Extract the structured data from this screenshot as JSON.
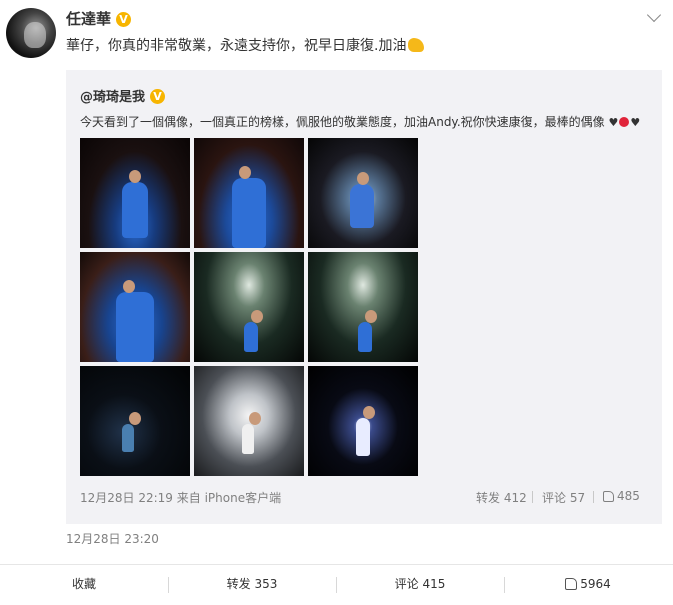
{
  "post": {
    "author": "任達華",
    "verified_badge": "V",
    "text": "華仔，你真的非常敬業，永遠支持你，祝早日康復.加油",
    "time": "12月28日 23:20"
  },
  "repost": {
    "author": "@琦琦是我",
    "verified_badge": "V",
    "text": "今天看到了一個偶像，一個真正的榜樣，佩服他的敬業態度，加油Andy.祝你快速康復，最棒的偶像",
    "hearts": "♥",
    "hearts_end": "♥",
    "meta": "12月28日 22:19 来自 iPhone客户端",
    "actions": {
      "repost": "转发 412",
      "comment": "评论 57",
      "like": "485"
    }
  },
  "bottom_bar": {
    "favorite": "收藏",
    "repost": "转发 353",
    "comment": "评论 415",
    "like": "5964"
  },
  "colors": {
    "verified": "#f7b500",
    "repost_bg": "#f2f2f5",
    "meta_text": "#808080"
  }
}
